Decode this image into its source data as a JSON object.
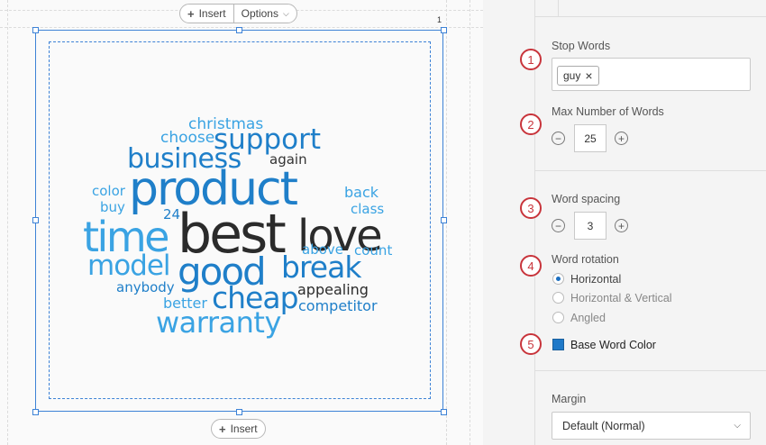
{
  "toolbar": {
    "insert_label": "Insert",
    "options_label": "Options",
    "bottom_insert_label": "Insert",
    "page_number": "1"
  },
  "wordcloud": {
    "words": [
      {
        "text": "christmas",
        "color": "#3aa3e3"
      },
      {
        "text": "choose",
        "color": "#3aa3e3"
      },
      {
        "text": "support",
        "color": "#1f7fc9"
      },
      {
        "text": "business",
        "color": "#1f7fc9"
      },
      {
        "text": "again",
        "color": "#333333"
      },
      {
        "text": "product",
        "color": "#1f7fc9"
      },
      {
        "text": "back",
        "color": "#3aa3e3"
      },
      {
        "text": "color",
        "color": "#3aa3e3"
      },
      {
        "text": "buy",
        "color": "#3aa3e3"
      },
      {
        "text": "class",
        "color": "#3aa3e3"
      },
      {
        "text": "24",
        "color": "#1f7fc9"
      },
      {
        "text": "time",
        "color": "#3aa3e3"
      },
      {
        "text": "best",
        "color": "#2b2b2b"
      },
      {
        "text": "love",
        "color": "#2b2b2b"
      },
      {
        "text": "above",
        "color": "#3aa3e3"
      },
      {
        "text": "count",
        "color": "#3aa3e3"
      },
      {
        "text": "model",
        "color": "#3aa3e3"
      },
      {
        "text": "good",
        "color": "#1f7fc9"
      },
      {
        "text": "break",
        "color": "#1f7fc9"
      },
      {
        "text": "anybody",
        "color": "#1f7fc9"
      },
      {
        "text": "cheap",
        "color": "#1f7fc9"
      },
      {
        "text": "appealing",
        "color": "#2b2b2b"
      },
      {
        "text": "better",
        "color": "#3aa3e3"
      },
      {
        "text": "competitor",
        "color": "#1f7fc9"
      },
      {
        "text": "warranty",
        "color": "#3aa3e3"
      }
    ]
  },
  "panel": {
    "stop_words": {
      "label": "Stop Words",
      "badge": "1",
      "tags": [
        {
          "text": "guy",
          "remove": "×"
        }
      ]
    },
    "max_words": {
      "label": "Max Number of Words",
      "badge": "2",
      "value": "25",
      "minus": "−",
      "plus": "+"
    },
    "word_spacing": {
      "label": "Word spacing",
      "badge": "3",
      "value": "3",
      "minus": "−",
      "plus": "+"
    },
    "word_rotation": {
      "label": "Word rotation",
      "badge": "4",
      "options": [
        {
          "label": "Horizontal",
          "selected": true
        },
        {
          "label": "Horizontal & Vertical",
          "selected": false
        },
        {
          "label": "Angled",
          "selected": false
        }
      ]
    },
    "base_color": {
      "label": "Base Word Color",
      "badge": "5",
      "color": "#1f79c8"
    },
    "margin": {
      "label": "Margin",
      "value": "Default (Normal)"
    }
  }
}
